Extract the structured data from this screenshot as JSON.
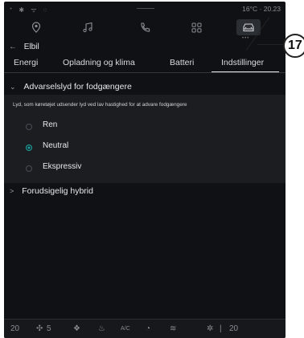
{
  "status_bar": {
    "left": "ᐩ ✱ ᯤ ◌",
    "right": "16°C · 20.23"
  },
  "nav_icons": [
    "location-icon",
    "music-icon",
    "phone-icon",
    "apps-icon",
    "car-icon"
  ],
  "breadcrumb": {
    "back": "←",
    "title": "Elbil"
  },
  "tabs": [
    {
      "label": "Energi"
    },
    {
      "label": "Opladning og klima"
    },
    {
      "label": "Batteri"
    },
    {
      "label": "Indstillinger"
    }
  ],
  "section": {
    "title": "Advarselslyd for fodgængere",
    "description": "Lyd, som køretøjet udsender lyd ved lav hastighed for at advare fodgængere",
    "options": [
      {
        "label": "Ren",
        "selected": false
      },
      {
        "label": "Neutral",
        "selected": true
      },
      {
        "label": "Ekspressiv",
        "selected": false
      }
    ]
  },
  "row2": {
    "label": "Forudsigelig hybrid"
  },
  "bottom_bar": {
    "left_temp": "20",
    "fan": "5",
    "ac": "A/C",
    "right_temp": "20"
  },
  "callout": {
    "number": "17"
  },
  "colors": {
    "accent": "#1aa3a0",
    "background": "#0f1114",
    "panel": "#1b1d21"
  }
}
